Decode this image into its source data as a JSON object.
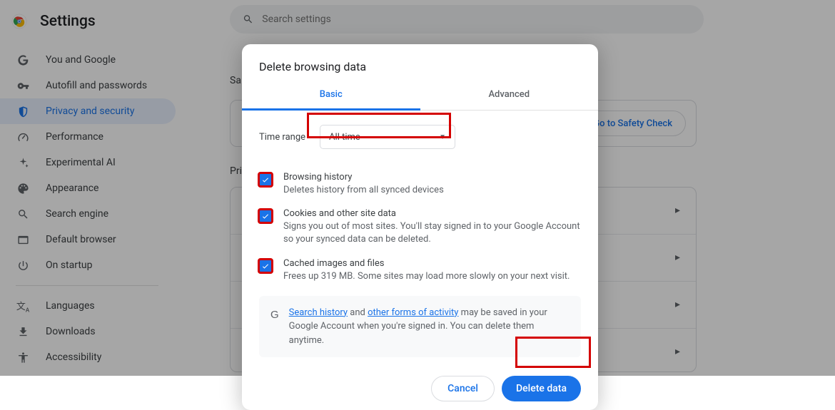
{
  "header": {
    "title": "Settings"
  },
  "search": {
    "placeholder": "Search settings"
  },
  "sidebar": {
    "items": [
      {
        "label": "You and Google"
      },
      {
        "label": "Autofill and passwords"
      },
      {
        "label": "Privacy and security"
      },
      {
        "label": "Performance"
      },
      {
        "label": "Experimental AI"
      },
      {
        "label": "Appearance"
      },
      {
        "label": "Search engine"
      },
      {
        "label": "Default browser"
      },
      {
        "label": "On startup"
      }
    ],
    "secondary": [
      {
        "label": "Languages"
      },
      {
        "label": "Downloads"
      },
      {
        "label": "Accessibility"
      }
    ]
  },
  "bg": {
    "safety_heading": "Sa",
    "privacy_heading": "Pri",
    "safety_check_btn": "Go to Safety Check"
  },
  "modal": {
    "title": "Delete browsing data",
    "tabs": {
      "basic": "Basic",
      "advanced": "Advanced"
    },
    "time_range_label": "Time range",
    "time_range_value": "All time",
    "options": [
      {
        "title": "Browsing history",
        "sub": "Deletes history from all synced devices"
      },
      {
        "title": "Cookies and other site data",
        "sub": "Signs you out of most sites. You'll stay signed in to your Google Account so your synced data can be deleted."
      },
      {
        "title": "Cached images and files",
        "sub": "Frees up 319 MB. Some sites may load more slowly on your next visit."
      }
    ],
    "info": {
      "link1": "Search history",
      "mid1": " and ",
      "link2": "other forms of activity",
      "rest": " may be saved in your Google Account when you're signed in. You can delete them anytime."
    },
    "actions": {
      "cancel": "Cancel",
      "delete": "Delete data"
    }
  }
}
